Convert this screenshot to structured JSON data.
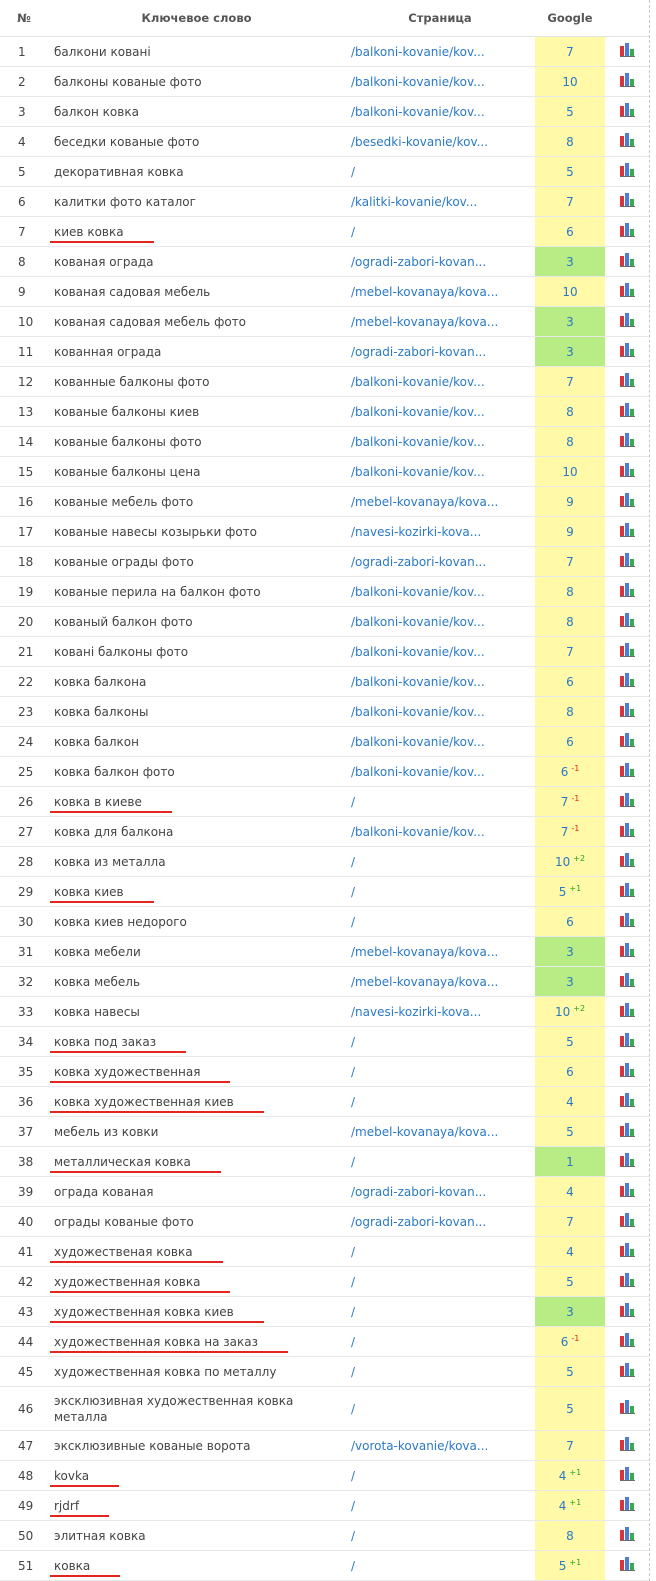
{
  "header": {
    "num": "№",
    "keyword": "Ключевое слово",
    "page": "Страница",
    "google": "Google"
  },
  "colors": {
    "position_default_bg": "#fff9a8",
    "position_top_bg": "#b8ec84",
    "link": "#2a79c7",
    "underline": "#e3251f",
    "delta_up": "#21a71d",
    "delta_down": "#e0211e"
  },
  "row_icon": "bar-chart-icon",
  "rows": [
    {
      "n": "1",
      "kw": "балкони ковані",
      "page": "/balkoni-kovanie/kov...",
      "pos": "7",
      "delta": "",
      "hl": false,
      "ul": false
    },
    {
      "n": "2",
      "kw": "балконы кованые фото",
      "page": "/balkoni-kovanie/kov...",
      "pos": "10",
      "delta": "",
      "hl": false,
      "ul": false
    },
    {
      "n": "3",
      "kw": "балкон ковка",
      "page": "/balkoni-kovanie/kov...",
      "pos": "5",
      "delta": "",
      "hl": false,
      "ul": false
    },
    {
      "n": "4",
      "kw": "беседки кованые фото",
      "page": "/besedki-kovanie/kov...",
      "pos": "8",
      "delta": "",
      "hl": false,
      "ul": false
    },
    {
      "n": "5",
      "kw": "декоративная ковка",
      "page": "/",
      "pos": "5",
      "delta": "",
      "hl": false,
      "ul": false
    },
    {
      "n": "6",
      "kw": "калитки фото каталог",
      "page": "/kalitki-kovanie/kov...",
      "pos": "7",
      "delta": "",
      "hl": false,
      "ul": false
    },
    {
      "n": "7",
      "kw": "киев ковка",
      "page": "/",
      "pos": "6",
      "delta": "",
      "hl": false,
      "ul": true
    },
    {
      "n": "8",
      "kw": "кованая ограда",
      "page": "/ogradi-zabori-kovan...",
      "pos": "3",
      "delta": "",
      "hl": true,
      "ul": false
    },
    {
      "n": "9",
      "kw": "кованая садовая мебель",
      "page": "/mebel-kovanaya/kova...",
      "pos": "10",
      "delta": "",
      "hl": false,
      "ul": false
    },
    {
      "n": "10",
      "kw": "кованая садовая мебель фото",
      "page": "/mebel-kovanaya/kova...",
      "pos": "3",
      "delta": "",
      "hl": true,
      "ul": false
    },
    {
      "n": "11",
      "kw": "кованная ограда",
      "page": "/ogradi-zabori-kovan...",
      "pos": "3",
      "delta": "",
      "hl": true,
      "ul": false
    },
    {
      "n": "12",
      "kw": "кованные балконы фото",
      "page": "/balkoni-kovanie/kov...",
      "pos": "7",
      "delta": "",
      "hl": false,
      "ul": false
    },
    {
      "n": "13",
      "kw": "кованые балконы киев",
      "page": "/balkoni-kovanie/kov...",
      "pos": "8",
      "delta": "",
      "hl": false,
      "ul": false
    },
    {
      "n": "14",
      "kw": "кованые балконы фото",
      "page": "/balkoni-kovanie/kov...",
      "pos": "8",
      "delta": "",
      "hl": false,
      "ul": false
    },
    {
      "n": "15",
      "kw": "кованые балконы цена",
      "page": "/balkoni-kovanie/kov...",
      "pos": "10",
      "delta": "",
      "hl": false,
      "ul": false
    },
    {
      "n": "16",
      "kw": "кованые мебель фото",
      "page": "/mebel-kovanaya/kova...",
      "pos": "9",
      "delta": "",
      "hl": false,
      "ul": false
    },
    {
      "n": "17",
      "kw": "кованые навесы козырьки фото",
      "page": "/navesi-kozirki-kova...",
      "pos": "9",
      "delta": "",
      "hl": false,
      "ul": false
    },
    {
      "n": "18",
      "kw": "кованые ограды фото",
      "page": "/ogradi-zabori-kovan...",
      "pos": "7",
      "delta": "",
      "hl": false,
      "ul": false
    },
    {
      "n": "19",
      "kw": "кованые перила на балкон фото",
      "page": "/balkoni-kovanie/kov...",
      "pos": "8",
      "delta": "",
      "hl": false,
      "ul": false
    },
    {
      "n": "20",
      "kw": "кованый балкон фото",
      "page": "/balkoni-kovanie/kov...",
      "pos": "8",
      "delta": "",
      "hl": false,
      "ul": false
    },
    {
      "n": "21",
      "kw": "ковані балконы фото",
      "page": "/balkoni-kovanie/kov...",
      "pos": "7",
      "delta": "",
      "hl": false,
      "ul": false
    },
    {
      "n": "22",
      "kw": "ковка балкона",
      "page": "/balkoni-kovanie/kov...",
      "pos": "6",
      "delta": "",
      "hl": false,
      "ul": false
    },
    {
      "n": "23",
      "kw": "ковка балконы",
      "page": "/balkoni-kovanie/kov...",
      "pos": "8",
      "delta": "",
      "hl": false,
      "ul": false
    },
    {
      "n": "24",
      "kw": "ковка балкон",
      "page": "/balkoni-kovanie/kov...",
      "pos": "6",
      "delta": "",
      "hl": false,
      "ul": false
    },
    {
      "n": "25",
      "kw": "ковка балкон фото",
      "page": "/balkoni-kovanie/kov...",
      "pos": "6",
      "delta": "-1",
      "hl": false,
      "ul": false
    },
    {
      "n": "26",
      "kw": "ковка в киеве",
      "page": "/",
      "pos": "7",
      "delta": "-1",
      "hl": false,
      "ul": true
    },
    {
      "n": "27",
      "kw": "ковка для балкона",
      "page": "/balkoni-kovanie/kov...",
      "pos": "7",
      "delta": "-1",
      "hl": false,
      "ul": false
    },
    {
      "n": "28",
      "kw": "ковка из металла",
      "page": "/",
      "pos": "10",
      "delta": "+2",
      "hl": false,
      "ul": false
    },
    {
      "n": "29",
      "kw": "ковка киев",
      "page": "/",
      "pos": "5",
      "delta": "+1",
      "hl": false,
      "ul": true
    },
    {
      "n": "30",
      "kw": "ковка киев недорого",
      "page": "/",
      "pos": "6",
      "delta": "",
      "hl": false,
      "ul": false
    },
    {
      "n": "31",
      "kw": "ковка мебели",
      "page": "/mebel-kovanaya/kova...",
      "pos": "3",
      "delta": "",
      "hl": true,
      "ul": false
    },
    {
      "n": "32",
      "kw": "ковка мебель",
      "page": "/mebel-kovanaya/kova...",
      "pos": "3",
      "delta": "",
      "hl": true,
      "ul": false
    },
    {
      "n": "33",
      "kw": "ковка навесы",
      "page": "/navesi-kozirki-kova...",
      "pos": "10",
      "delta": "+2",
      "hl": false,
      "ul": false
    },
    {
      "n": "34",
      "kw": "ковка под заказ",
      "page": "/",
      "pos": "5",
      "delta": "",
      "hl": false,
      "ul": true
    },
    {
      "n": "35",
      "kw": "ковка художественная",
      "page": "/",
      "pos": "6",
      "delta": "",
      "hl": false,
      "ul": true
    },
    {
      "n": "36",
      "kw": "ковка художественная киев",
      "page": "/",
      "pos": "4",
      "delta": "",
      "hl": false,
      "ul": true
    },
    {
      "n": "37",
      "kw": "мебель из ковки",
      "page": "/mebel-kovanaya/kova...",
      "pos": "5",
      "delta": "",
      "hl": false,
      "ul": false
    },
    {
      "n": "38",
      "kw": "металлическая ковка",
      "page": "/",
      "pos": "1",
      "delta": "",
      "hl": true,
      "ul": true
    },
    {
      "n": "39",
      "kw": "ограда кованая",
      "page": "/ogradi-zabori-kovan...",
      "pos": "4",
      "delta": "",
      "hl": false,
      "ul": false
    },
    {
      "n": "40",
      "kw": "ограды кованые фото",
      "page": "/ogradi-zabori-kovan...",
      "pos": "7",
      "delta": "",
      "hl": false,
      "ul": false
    },
    {
      "n": "41",
      "kw": "художественая ковка",
      "page": "/",
      "pos": "4",
      "delta": "",
      "hl": false,
      "ul": true
    },
    {
      "n": "42",
      "kw": "художественная ковка",
      "page": "/",
      "pos": "5",
      "delta": "",
      "hl": false,
      "ul": true
    },
    {
      "n": "43",
      "kw": "художественная ковка киев",
      "page": "/",
      "pos": "3",
      "delta": "",
      "hl": true,
      "ul": true
    },
    {
      "n": "44",
      "kw": "художественная ковка на заказ",
      "page": "/",
      "pos": "6",
      "delta": "-1",
      "hl": false,
      "ul": true
    },
    {
      "n": "45",
      "kw": "художественная ковка по металлу",
      "page": "/",
      "pos": "5",
      "delta": "",
      "hl": false,
      "ul": false
    },
    {
      "n": "46",
      "kw": "эксклюзивная художественная ковка металла",
      "page": "/",
      "pos": "5",
      "delta": "",
      "hl": false,
      "ul": false,
      "tall": true
    },
    {
      "n": "47",
      "kw": "эксклюзивные кованые ворота",
      "page": "/vorota-kovanie/kova...",
      "pos": "7",
      "delta": "",
      "hl": false,
      "ul": false
    },
    {
      "n": "48",
      "kw": "kovka",
      "page": "/",
      "pos": "4",
      "delta": "+1",
      "hl": false,
      "ul": true
    },
    {
      "n": "49",
      "kw": "rjdrf",
      "page": "/",
      "pos": "4",
      "delta": "+1",
      "hl": false,
      "ul": true
    },
    {
      "n": "50",
      "kw": "элитная ковка",
      "page": "/",
      "pos": "8",
      "delta": "",
      "hl": false,
      "ul": false
    },
    {
      "n": "51",
      "kw": "ковка",
      "page": "/",
      "pos": "5",
      "delta": "+1",
      "hl": false,
      "ul": true
    }
  ]
}
